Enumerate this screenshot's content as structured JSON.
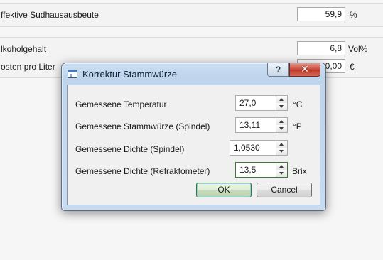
{
  "background": {
    "rows": [
      {
        "label": "ffektive Sudhausausbeute",
        "value": "59,9",
        "unit": "%"
      },
      {
        "label": "lkoholgehalt",
        "value": "6,8",
        "unit": "Vol%"
      },
      {
        "label": "osten pro Liter",
        "value": "0,00",
        "unit": "€"
      }
    ]
  },
  "dialog": {
    "title": "Korrektur Stammwürze",
    "help_label": "?",
    "close_label": "✕",
    "fields": [
      {
        "label": "Gemessene Temperatur",
        "value": "27,0",
        "unit": "°C"
      },
      {
        "label": "Gemessene Stammwürze (Spindel)",
        "value": "13,11",
        "unit": "°P"
      },
      {
        "label": "Gemessene Dichte (Spindel)",
        "value": "1,0530",
        "unit": ""
      },
      {
        "label": "Gemessene Dichte (Refraktometer)",
        "value": "13,5",
        "unit": "Brix"
      }
    ],
    "ok_label": "OK",
    "cancel_label": "Cancel"
  }
}
